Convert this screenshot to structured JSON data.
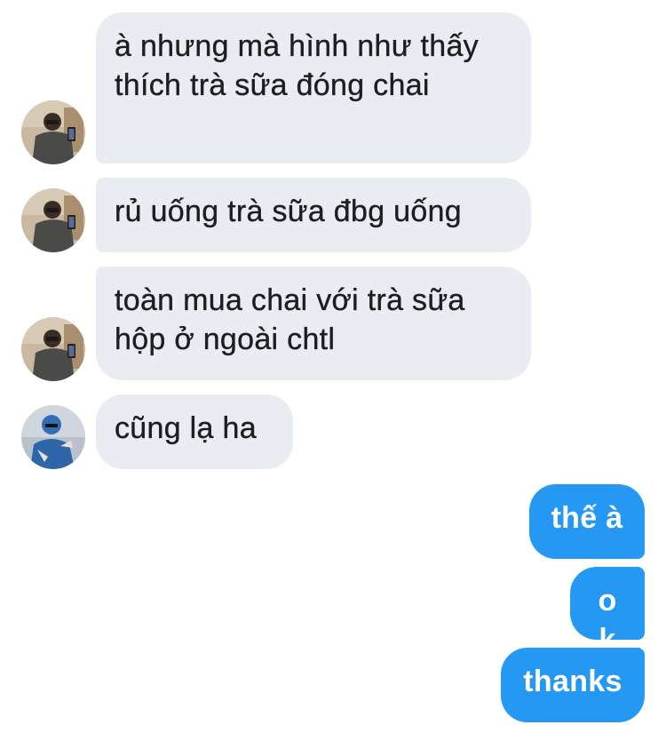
{
  "messages": [
    {
      "sender": "other",
      "text": "à nhưng mà hình như thấy thích trà sữa đóng chai"
    },
    {
      "sender": "other",
      "text": "rủ uống trà sữa đbg uống"
    },
    {
      "sender": "other",
      "text": "toàn mua chai với trà sữa hộp ở ngoài chtl"
    },
    {
      "sender": "other-2",
      "text": "cũng lạ ha"
    },
    {
      "sender": "me",
      "text": "thế à"
    },
    {
      "sender": "me",
      "text": "ok"
    },
    {
      "sender": "me",
      "text": "thanks"
    }
  ],
  "colors": {
    "incoming_bubble": "#e9ecf1",
    "outgoing_bubble": "#2498f3",
    "incoming_text": "#1c1e21",
    "outgoing_text": "#ffffff"
  },
  "icons": {
    "avatar_1": "user-avatar-photo",
    "avatar_2": "user-avatar-photo-blue"
  }
}
